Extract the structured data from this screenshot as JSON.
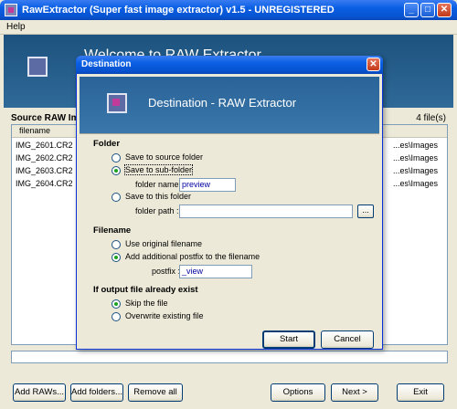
{
  "window": {
    "title": "RawExtractor (Super fast image extractor) v1.5 - UNREGISTERED",
    "minimize": "_",
    "maximize": "□",
    "close": "✕"
  },
  "menu": {
    "help": "Help"
  },
  "banner": {
    "text": "Welcome to RAW Extractor"
  },
  "file_list": {
    "heading": "Source RAW Images",
    "count": "4 file(s)",
    "column_filename": "filename",
    "files": [
      {
        "name": "IMG_2601.CR2",
        "path": "...es\\Images"
      },
      {
        "name": "IMG_2602.CR2",
        "path": "...es\\Images"
      },
      {
        "name": "IMG_2603.CR2",
        "path": "...es\\Images"
      },
      {
        "name": "IMG_2604.CR2",
        "path": "...es\\Images"
      }
    ]
  },
  "buttons": {
    "add_raws": "Add RAWs...",
    "add_folders": "Add folders...",
    "remove_all": "Remove all",
    "options": "Options",
    "next": "Next >",
    "exit": "Exit"
  },
  "dialog": {
    "title": "Destination",
    "close": "✕",
    "banner_text": "Destination - RAW Extractor",
    "folder": {
      "heading": "Folder",
      "save_to_source": "Save to source folder",
      "save_to_sub": "Save to sub-folder",
      "folder_name_label": "folder name :",
      "folder_name_value": "preview",
      "save_to_this": "Save to this folder",
      "folder_path_label": "folder path :",
      "folder_path_value": "",
      "browse": "...",
      "selected": "save_to_sub"
    },
    "filename": {
      "heading": "Filename",
      "use_original": "Use original filename",
      "add_postfix": "Add additional postfix to the filename",
      "postfix_label": "postfix :",
      "postfix_value": "_view",
      "selected": "add_postfix"
    },
    "exists": {
      "heading": "If output file already exist",
      "skip": "Skip the file",
      "overwrite": "Overwrite existing file",
      "selected": "skip"
    },
    "start": "Start",
    "cancel": "Cancel"
  }
}
